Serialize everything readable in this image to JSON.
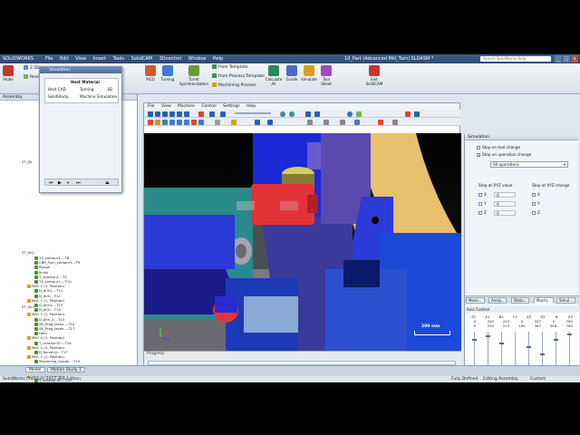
{
  "app": {
    "logo": "SOLIDWORKS",
    "menu": [
      "File",
      "Edit",
      "View",
      "Insert",
      "Tools",
      "SolidCAM",
      "3Dcontrol",
      "Window",
      "Help"
    ],
    "document_title": "10_Part (Advanced Mill_Turn).SLDASM *",
    "search_placeholder": "Search SolidWorks Help",
    "window_buttons": [
      "_",
      "□",
      "x"
    ]
  },
  "ribbon": {
    "left_buttons": [
      "Probe",
      "Machine Simulation"
    ],
    "tool_buttons": [
      "MCO",
      "Turning",
      "Turret Synchronization",
      "Calculate All",
      "Gcode",
      "Simulate",
      "Tool Sheet",
      "Exit SolidCAM"
    ],
    "list_items": [
      "from Template",
      "from Process Template",
      "Machining Process"
    ],
    "left_labels": [
      "2.5D",
      "Recognition"
    ]
  },
  "left_panel": {
    "tab_label": "Assembly",
    "tree_items": [
      "T4_contour1....T8",
      "CBR_Turn_contour1...T9",
      "Rough",
      "finish",
      "T_contour4....T5",
      "T4_contour1....T10",
      "MAC 1 (1- Position)",
      "D_drill1....T11",
      "D_drill....T12",
      "MAC 1 (1- Position)",
      "D_drill1....T13",
      "D_drill....T14",
      "MAC 1 (1- Position)",
      "D_drill_2....T15",
      "SK_Prog_facex....T16",
      "SK_Prog_facex....T17",
      "Hold",
      "MAC 4 (1- Position)",
      "T_contour10....T18",
      "MAC 1 (1- Position)",
      "D_facemill....T17",
      "MAC 1 (1- Position)",
      "Machining_model....T19",
      "MAC 1 (1- Position)",
      "T_contour17....T19",
      "MAC 1 (1- Position)",
      "T_contour18....T19"
    ],
    "group_labels": [
      "ST_Sh",
      "ST_Sh2",
      "ST_Sh3"
    ]
  },
  "sim_dialog": {
    "title": "Simulation",
    "table_header": "Host Material",
    "row1": [
      "Host CAD",
      "Turning",
      "3D"
    ],
    "row2": [
      "SolidStudy",
      "Machine Simulation"
    ]
  },
  "machine_window": {
    "menu": [
      "File",
      "View",
      "Machine",
      "Control",
      "Settings",
      "Help"
    ],
    "scale_label": "200 mm",
    "progress_label": "Progress"
  },
  "right_panel": {
    "header": "Simulation",
    "checkbox_stop_tool_change": "Stop on tool change",
    "checkbox_stop_operation_change": "Stop on operation change",
    "stop_operation_checked": true,
    "combo_value": "All operations",
    "stop_xyz_value": "Stop at XYZ value",
    "stop_xyz_change": "Stop at XYZ change",
    "axis_checks_left": [
      "X",
      "Y",
      "Z"
    ],
    "axis_checks_right": [
      "X",
      "Y",
      "Z"
    ],
    "field_values": [
      "0",
      "0",
      "0"
    ],
    "tabs": [
      "Move...",
      "Analy...",
      "Statu...",
      "Machi...",
      "Simul..."
    ],
    "active_tab_index": 3,
    "axis_control_title": "Axis Control",
    "axis_headers": [
      "Z1",
      "X1",
      "B1",
      "C1",
      "Z2",
      "X2",
      "B",
      "Z3"
    ],
    "axis_row1": [
      "0",
      "319",
      "213",
      "0",
      "327",
      "0",
      "790"
    ],
    "axis_row2": [
      "0",
      "319",
      "213",
      "190",
      "367",
      "618",
      "790"
    ],
    "slider_positions": [
      0.2,
      0.1,
      0.3,
      0.95,
      0.4,
      0.6,
      0.2,
      0.05
    ]
  },
  "bottom": {
    "tabs": [
      "Model",
      "Motion Study 1"
    ],
    "status_left": "SolidWorks Premium 2012 x64 Edition",
    "status_right": [
      "Fully Defined",
      "Editing Assembly",
      "Custom"
    ]
  },
  "colors": {
    "machine_blue": "#1a2ad6",
    "tool_red": "#e43338",
    "housing_tan": "#e8c170",
    "purple": "#6a5acd",
    "teal": "#2e8b8b"
  }
}
